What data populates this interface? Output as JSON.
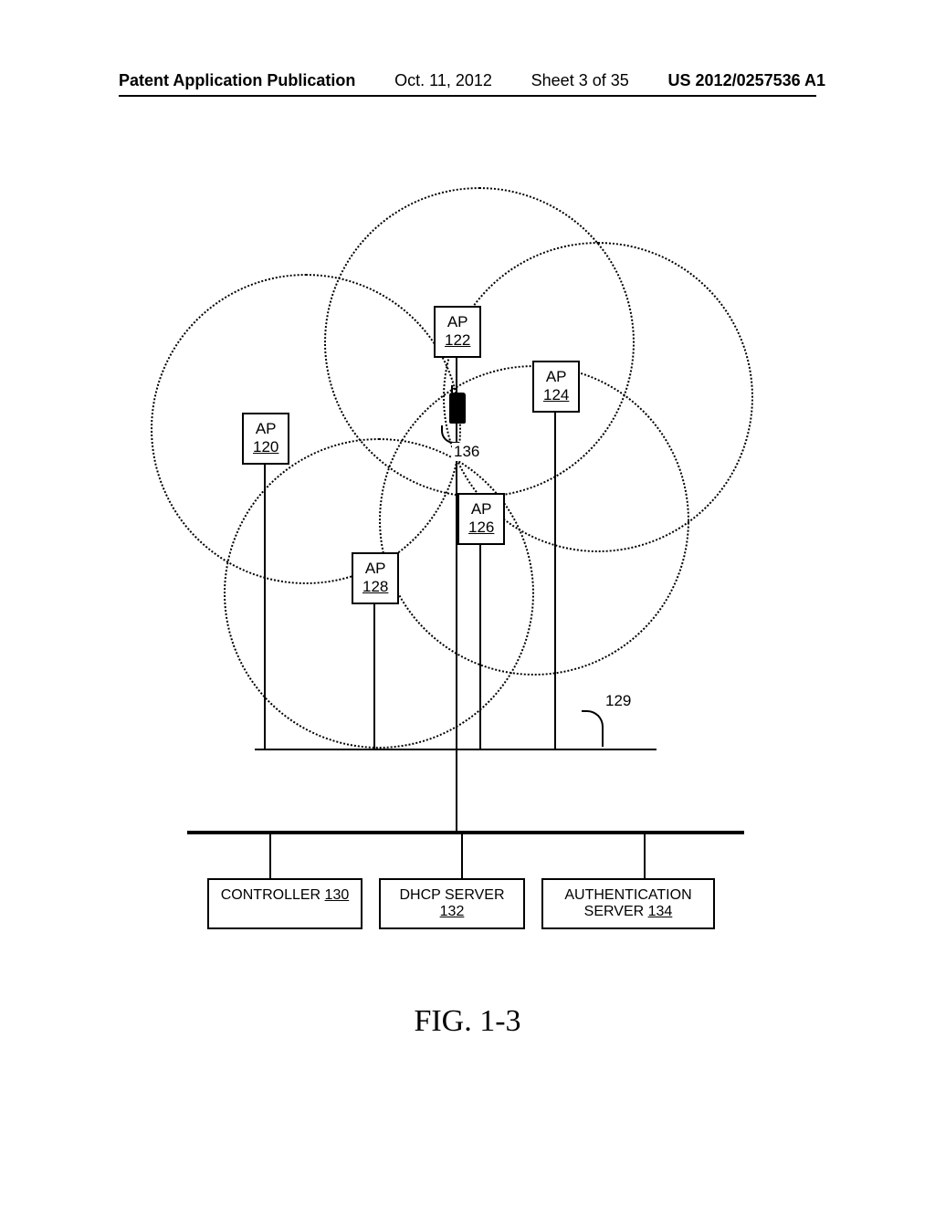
{
  "header": {
    "publication_type": "Patent Application Publication",
    "date": "Oct. 11, 2012",
    "sheet": "Sheet 3 of 35",
    "pub_number": "US 2012/0257536 A1"
  },
  "figure_label": "FIG. 1-3",
  "ap_label": "AP",
  "aps": {
    "120": "120",
    "122": "122",
    "124": "124",
    "126": "126",
    "128": "128"
  },
  "device_ref": "136",
  "network_ref": "129",
  "servers": {
    "controller": {
      "label": "CONTROLLER",
      "num": "130"
    },
    "dhcp": {
      "label": "DHCP SERVER",
      "num": "132"
    },
    "auth": {
      "label": "AUTHENTICATION SERVER",
      "num": "134"
    }
  }
}
